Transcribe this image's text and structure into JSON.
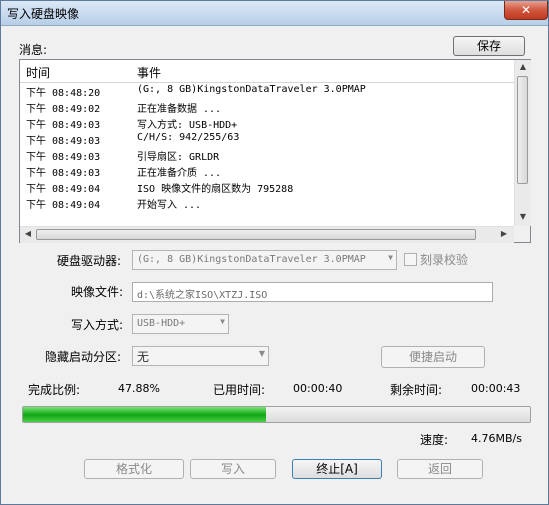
{
  "window": {
    "title": "写入硬盘映像",
    "close_glyph": "✕"
  },
  "messages": {
    "label": "消息:",
    "save_label": "保存"
  },
  "log": {
    "columns": [
      "时间",
      "事件"
    ],
    "rows": [
      [
        "下午 08:48:20",
        "(G:, 8 GB)KingstonDataTraveler 3.0PMAP"
      ],
      [
        "下午 08:49:02",
        "正在准备数据 ..."
      ],
      [
        "下午 08:49:03",
        "写入方式: USB-HDD+"
      ],
      [
        "下午 08:49:03",
        "C/H/S: 942/255/63"
      ],
      [
        "下午 08:49:03",
        "引导扇区: GRLDR"
      ],
      [
        "下午 08:49:03",
        "正在准备介质 ..."
      ],
      [
        "下午 08:49:04",
        "ISO 映像文件的扇区数为 795288"
      ],
      [
        "下午 08:49:04",
        "开始写入 ..."
      ]
    ]
  },
  "form": {
    "drive_label": "硬盘驱动器:",
    "drive_value": "(G:, 8 GB)KingstonDataTraveler 3.0PMAP",
    "verify_label": "刻录校验",
    "image_label": "映像文件:",
    "image_value": "d:\\系统之家ISO\\XTZJ.ISO",
    "write_mode_label": "写入方式:",
    "write_mode_value": "USB-HDD+",
    "hidden_partition_label": "隐藏启动分区:",
    "hidden_partition_value": "无",
    "quick_boot_label": "便捷启动"
  },
  "progress": {
    "ratio_label": "完成比例:",
    "ratio_value": "47.88%",
    "fraction": 0.4788,
    "elapsed_label": "已用时间:",
    "elapsed_value": "00:00:40",
    "remaining_label": "剩余时间:",
    "remaining_value": "00:00:43",
    "speed_label": "速度:",
    "speed_value": "4.76MB/s"
  },
  "buttons": {
    "format": "格式化",
    "write": "写入",
    "stop": "终止[A]",
    "back": "返回"
  },
  "colors": {
    "progress_fill": "#1fb01f",
    "title_bar": "#c6d9ee",
    "close": "#c0391e"
  }
}
